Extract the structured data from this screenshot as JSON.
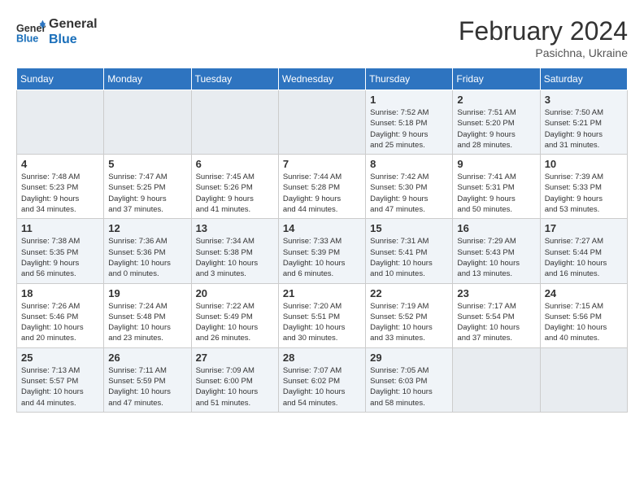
{
  "header": {
    "logo_line1": "General",
    "logo_line2": "Blue",
    "month_title": "February 2024",
    "location": "Pasichna, Ukraine"
  },
  "days_of_week": [
    "Sunday",
    "Monday",
    "Tuesday",
    "Wednesday",
    "Thursday",
    "Friday",
    "Saturday"
  ],
  "weeks": [
    [
      {
        "day": "",
        "info": ""
      },
      {
        "day": "",
        "info": ""
      },
      {
        "day": "",
        "info": ""
      },
      {
        "day": "",
        "info": ""
      },
      {
        "day": "1",
        "info": "Sunrise: 7:52 AM\nSunset: 5:18 PM\nDaylight: 9 hours\nand 25 minutes."
      },
      {
        "day": "2",
        "info": "Sunrise: 7:51 AM\nSunset: 5:20 PM\nDaylight: 9 hours\nand 28 minutes."
      },
      {
        "day": "3",
        "info": "Sunrise: 7:50 AM\nSunset: 5:21 PM\nDaylight: 9 hours\nand 31 minutes."
      }
    ],
    [
      {
        "day": "4",
        "info": "Sunrise: 7:48 AM\nSunset: 5:23 PM\nDaylight: 9 hours\nand 34 minutes."
      },
      {
        "day": "5",
        "info": "Sunrise: 7:47 AM\nSunset: 5:25 PM\nDaylight: 9 hours\nand 37 minutes."
      },
      {
        "day": "6",
        "info": "Sunrise: 7:45 AM\nSunset: 5:26 PM\nDaylight: 9 hours\nand 41 minutes."
      },
      {
        "day": "7",
        "info": "Sunrise: 7:44 AM\nSunset: 5:28 PM\nDaylight: 9 hours\nand 44 minutes."
      },
      {
        "day": "8",
        "info": "Sunrise: 7:42 AM\nSunset: 5:30 PM\nDaylight: 9 hours\nand 47 minutes."
      },
      {
        "day": "9",
        "info": "Sunrise: 7:41 AM\nSunset: 5:31 PM\nDaylight: 9 hours\nand 50 minutes."
      },
      {
        "day": "10",
        "info": "Sunrise: 7:39 AM\nSunset: 5:33 PM\nDaylight: 9 hours\nand 53 minutes."
      }
    ],
    [
      {
        "day": "11",
        "info": "Sunrise: 7:38 AM\nSunset: 5:35 PM\nDaylight: 9 hours\nand 56 minutes."
      },
      {
        "day": "12",
        "info": "Sunrise: 7:36 AM\nSunset: 5:36 PM\nDaylight: 10 hours\nand 0 minutes."
      },
      {
        "day": "13",
        "info": "Sunrise: 7:34 AM\nSunset: 5:38 PM\nDaylight: 10 hours\nand 3 minutes."
      },
      {
        "day": "14",
        "info": "Sunrise: 7:33 AM\nSunset: 5:39 PM\nDaylight: 10 hours\nand 6 minutes."
      },
      {
        "day": "15",
        "info": "Sunrise: 7:31 AM\nSunset: 5:41 PM\nDaylight: 10 hours\nand 10 minutes."
      },
      {
        "day": "16",
        "info": "Sunrise: 7:29 AM\nSunset: 5:43 PM\nDaylight: 10 hours\nand 13 minutes."
      },
      {
        "day": "17",
        "info": "Sunrise: 7:27 AM\nSunset: 5:44 PM\nDaylight: 10 hours\nand 16 minutes."
      }
    ],
    [
      {
        "day": "18",
        "info": "Sunrise: 7:26 AM\nSunset: 5:46 PM\nDaylight: 10 hours\nand 20 minutes."
      },
      {
        "day": "19",
        "info": "Sunrise: 7:24 AM\nSunset: 5:48 PM\nDaylight: 10 hours\nand 23 minutes."
      },
      {
        "day": "20",
        "info": "Sunrise: 7:22 AM\nSunset: 5:49 PM\nDaylight: 10 hours\nand 26 minutes."
      },
      {
        "day": "21",
        "info": "Sunrise: 7:20 AM\nSunset: 5:51 PM\nDaylight: 10 hours\nand 30 minutes."
      },
      {
        "day": "22",
        "info": "Sunrise: 7:19 AM\nSunset: 5:52 PM\nDaylight: 10 hours\nand 33 minutes."
      },
      {
        "day": "23",
        "info": "Sunrise: 7:17 AM\nSunset: 5:54 PM\nDaylight: 10 hours\nand 37 minutes."
      },
      {
        "day": "24",
        "info": "Sunrise: 7:15 AM\nSunset: 5:56 PM\nDaylight: 10 hours\nand 40 minutes."
      }
    ],
    [
      {
        "day": "25",
        "info": "Sunrise: 7:13 AM\nSunset: 5:57 PM\nDaylight: 10 hours\nand 44 minutes."
      },
      {
        "day": "26",
        "info": "Sunrise: 7:11 AM\nSunset: 5:59 PM\nDaylight: 10 hours\nand 47 minutes."
      },
      {
        "day": "27",
        "info": "Sunrise: 7:09 AM\nSunset: 6:00 PM\nDaylight: 10 hours\nand 51 minutes."
      },
      {
        "day": "28",
        "info": "Sunrise: 7:07 AM\nSunset: 6:02 PM\nDaylight: 10 hours\nand 54 minutes."
      },
      {
        "day": "29",
        "info": "Sunrise: 7:05 AM\nSunset: 6:03 PM\nDaylight: 10 hours\nand 58 minutes."
      },
      {
        "day": "",
        "info": ""
      },
      {
        "day": "",
        "info": ""
      }
    ]
  ]
}
